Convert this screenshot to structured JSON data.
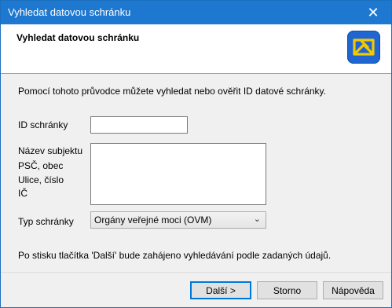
{
  "window": {
    "title": "Vyhledat datovou schránku",
    "close_glyph": "✕"
  },
  "header": {
    "title": "Vyhledat datovou schránku",
    "logo_icon": "databox-logo-icon"
  },
  "intro_text": "Pomocí tohoto průvodce můžete vyhledat nebo ověřit ID datové schránky.",
  "form": {
    "id_label": "ID schránky",
    "id_value": "",
    "subject_labels": [
      "Název subjektu",
      "PSČ, obec",
      "Ulice, číslo",
      "IČ"
    ],
    "subject_value": "",
    "type_label": "Typ schránky",
    "type_selected": "Orgány veřejné moci (OVM)"
  },
  "note": "Po stisku tlačítka 'Další' bude zahájeno vyhledávání podle zadaných údajů.",
  "buttons": {
    "next": "Další >",
    "cancel": "Storno",
    "help": "Nápověda"
  },
  "colors": {
    "titlebar": "#1e78d0",
    "logo": "#1f66d1",
    "logo_accent": "#f5c800"
  }
}
